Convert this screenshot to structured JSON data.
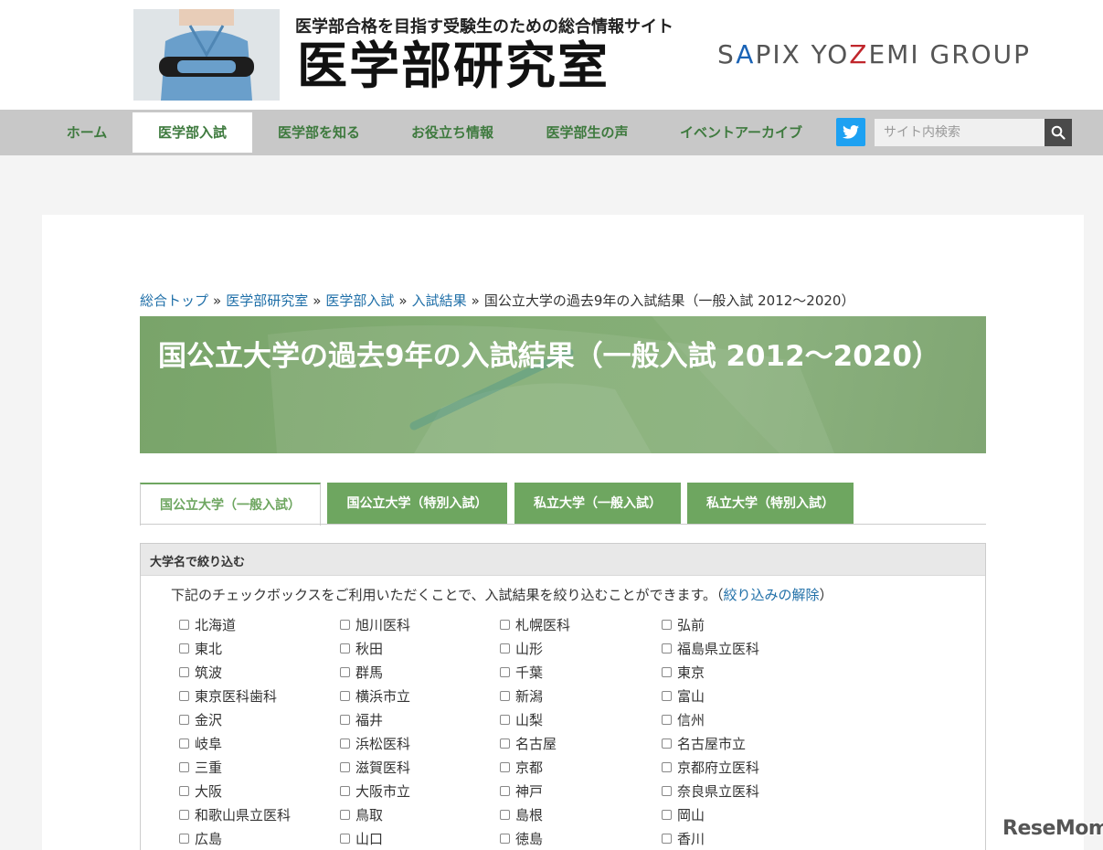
{
  "header": {
    "tagline": "医学部合格を目指す受験生のための総合情報サイト",
    "logo": "医学部研究室",
    "group_a": "S",
    "group_b": "A",
    "group_c": "PIX YO",
    "group_d": "Z",
    "group_e": "EMI GROUP"
  },
  "nav": {
    "items": [
      "ホーム",
      "医学部入試",
      "医学部を知る",
      "お役立ち情報",
      "医学部生の声",
      "イベントアーカイブ"
    ],
    "active_index": 1
  },
  "search": {
    "placeholder": "サイト内検索"
  },
  "breadcrumb": {
    "links": [
      "総合トップ",
      "医学部研究室",
      "医学部入試",
      "入試結果"
    ],
    "separator": "»",
    "current": "国公立大学の過去9年の入試結果（一般入試 2012～2020）"
  },
  "hero": {
    "title": "国公立大学の過去9年の入試結果（一般入試 2012～2020）"
  },
  "tabs": [
    "国公立大学（一般入試）",
    "国公立大学（特別入試）",
    "私立大学（一般入試）",
    "私立大学（特別入試）"
  ],
  "filter": {
    "heading": "大学名で絞り込む",
    "desc_before": "下記のチェックボックスをご利用いただくことで、入試結果を絞り込むことができます。（",
    "clear_link": "絞り込みの解除",
    "desc_after": "）",
    "universities": [
      "北海道",
      "旭川医科",
      "札幌医科",
      "弘前",
      "東北",
      "秋田",
      "山形",
      "福島県立医科",
      "筑波",
      "群馬",
      "千葉",
      "東京",
      "東京医科歯科",
      "横浜市立",
      "新潟",
      "富山",
      "金沢",
      "福井",
      "山梨",
      "信州",
      "岐阜",
      "浜松医科",
      "名古屋",
      "名古屋市立",
      "三重",
      "滋賀医科",
      "京都",
      "京都府立医科",
      "大阪",
      "大阪市立",
      "神戸",
      "奈良県立医科",
      "和歌山県立医科",
      "鳥取",
      "島根",
      "岡山",
      "広島",
      "山口",
      "徳島",
      "香川"
    ]
  },
  "watermark": "ReseMom"
}
